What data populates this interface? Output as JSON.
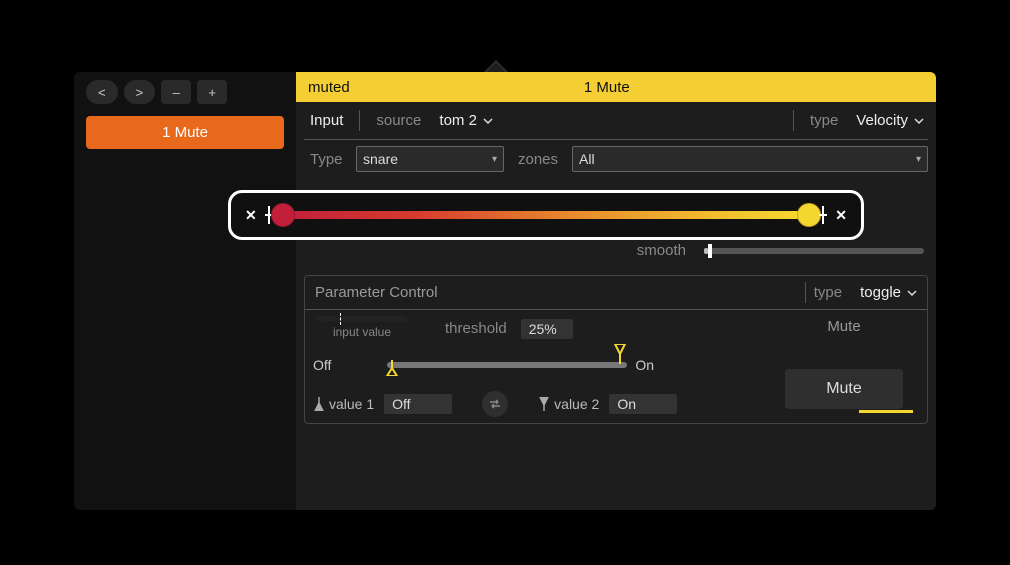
{
  "sidebar": {
    "nav": {
      "prev": "<",
      "next": ">",
      "remove": "–",
      "add": "+"
    },
    "active_tab": "1 Mute"
  },
  "header": {
    "status": "muted",
    "title": "1 Mute"
  },
  "input": {
    "label": "Input",
    "source_label": "source",
    "source_value": "tom 2",
    "type_label": "type",
    "type_value": "Velocity"
  },
  "type_row": {
    "type_label": "Type",
    "type_value": "snare",
    "zones_label": "zones",
    "zones_value": "All"
  },
  "range": {
    "low_pct": 0,
    "high_pct": 100
  },
  "smooth": {
    "label": "smooth",
    "value_pct": 2
  },
  "param": {
    "title": "Parameter Control",
    "type_label": "type",
    "type_value": "toggle",
    "input_value_label": "input value",
    "input_value_pct": 25,
    "threshold_label": "threshold",
    "threshold_value": "25%",
    "off_label": "Off",
    "on_label": "On",
    "toggle_low_pct": 0,
    "toggle_high_pct": 100,
    "value1_label": "value 1",
    "value1": "Off",
    "value2_label": "value 2",
    "value2": "On",
    "output_label": "Mute",
    "action_button": "Mute"
  }
}
